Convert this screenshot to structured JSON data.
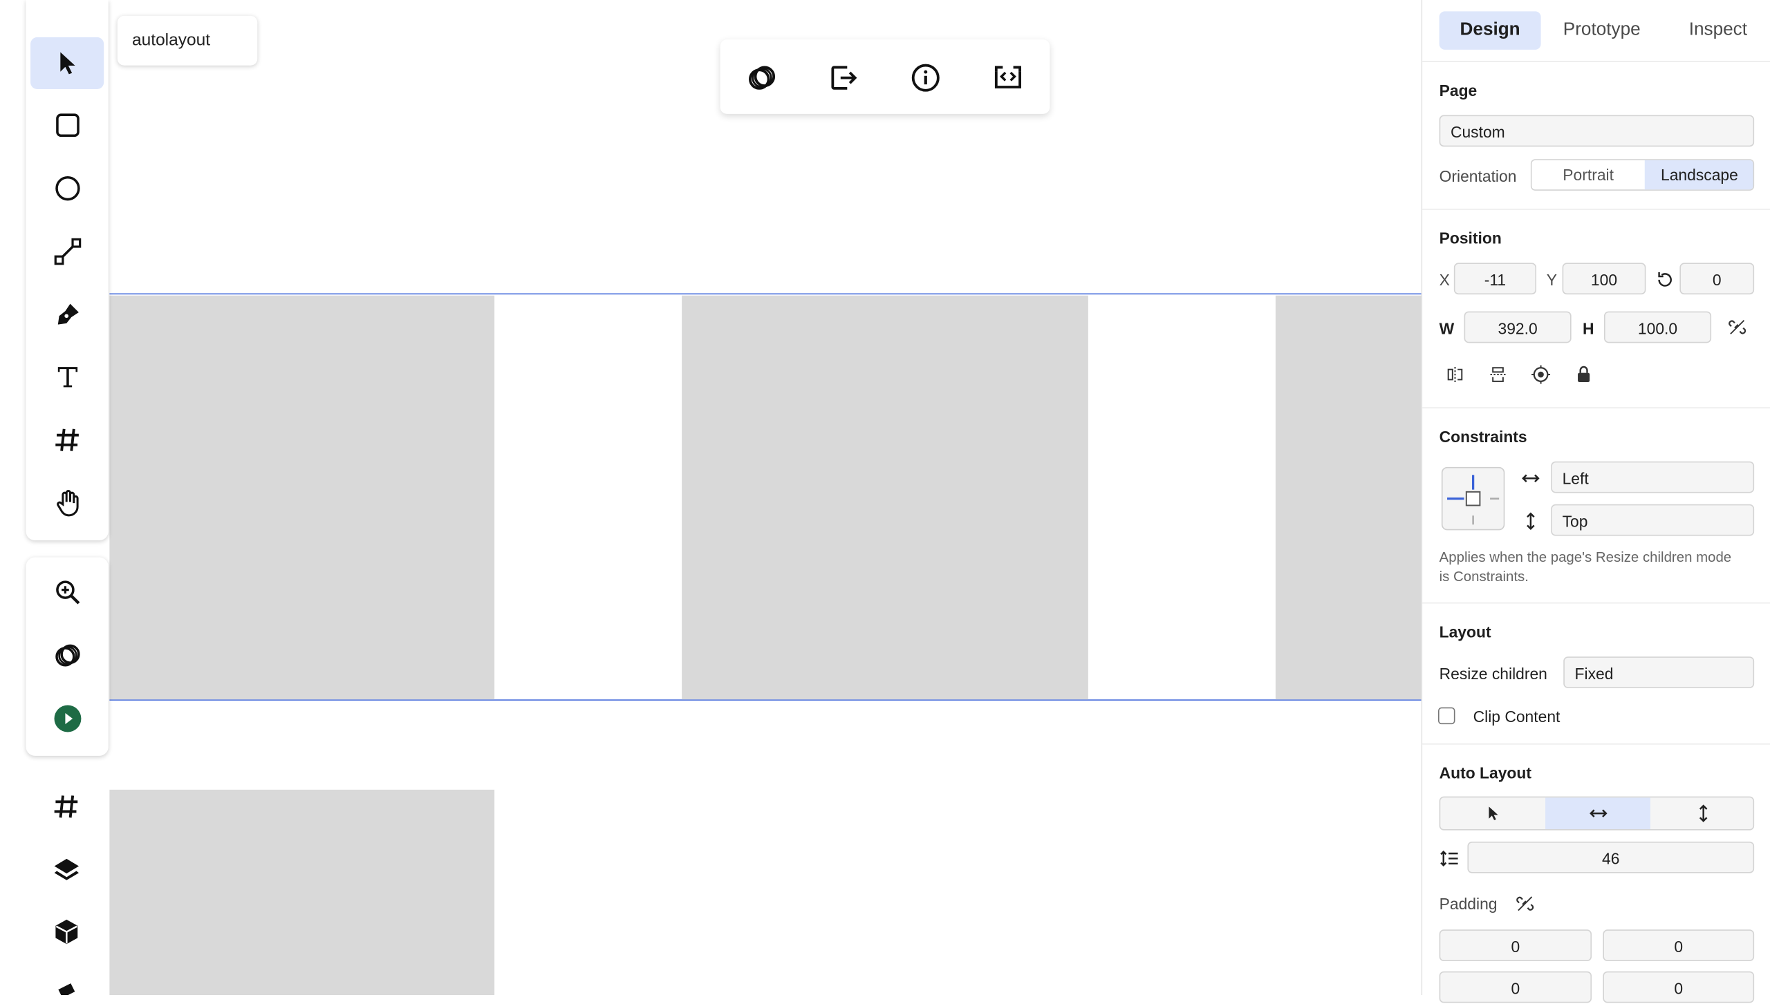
{
  "layer_tag": "autolayout",
  "tabs": [
    "Design",
    "Prototype",
    "Inspect"
  ],
  "page": {
    "title": "Page",
    "preset": "Custom",
    "orientation_label": "Orientation",
    "orientation_options": [
      "Portrait",
      "Landscape"
    ],
    "orientation_selected": "Landscape"
  },
  "position": {
    "title": "Position",
    "x_label": "X",
    "x": "-11",
    "y_label": "Y",
    "y": "100",
    "rotation": "0",
    "w_label": "W",
    "w": "392.0",
    "h_label": "H",
    "h": "100.0"
  },
  "constraints": {
    "title": "Constraints",
    "horizontal": "Left",
    "vertical": "Top",
    "note": "Applies when the page's Resize children mode is Constraints."
  },
  "layout": {
    "title": "Layout",
    "resize_label": "Resize children",
    "resize_value": "Fixed",
    "clip_label": "Clip Content",
    "clip_checked": false
  },
  "auto_layout": {
    "title": "Auto Layout",
    "direction_selected": "horizontal",
    "spacing": "46",
    "padding_label": "Padding",
    "padding": [
      "0",
      "0",
      "0",
      "0"
    ]
  },
  "colors": {
    "accent": "#dde6fb",
    "frame_line": "#4a6fdc",
    "block": "#d9d9d9",
    "play": "#1e6b45"
  }
}
